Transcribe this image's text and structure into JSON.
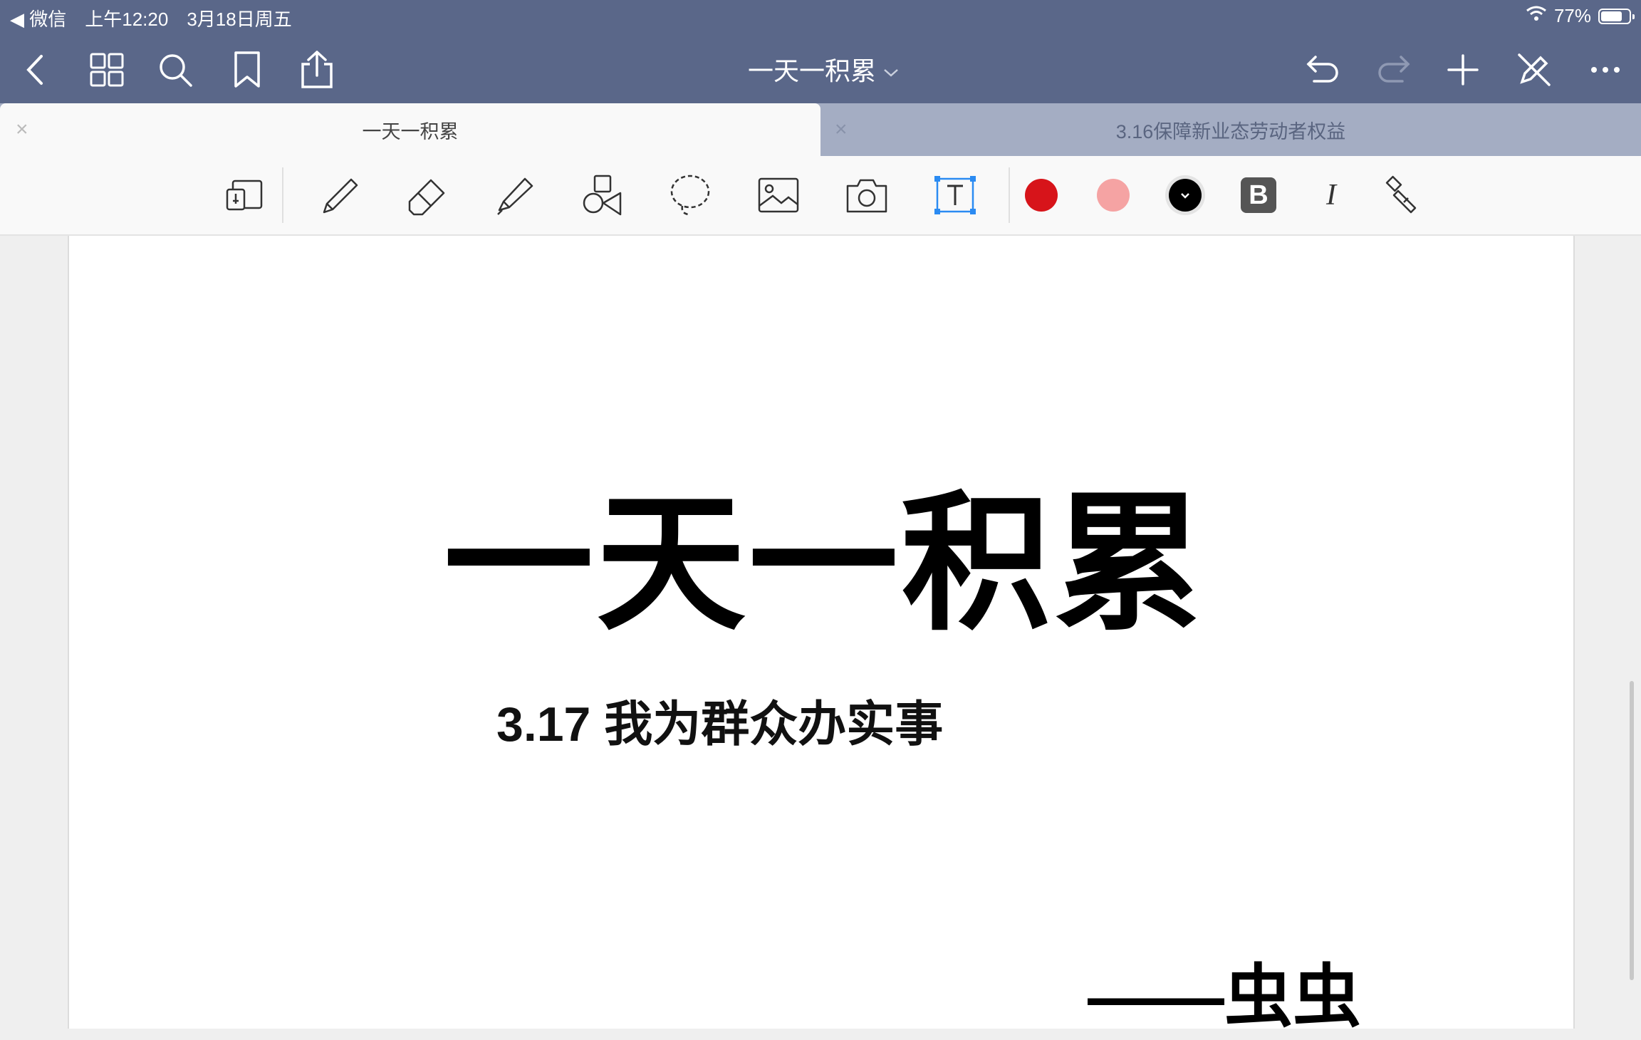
{
  "status_bar": {
    "back_app": "◀ 微信",
    "time": "上午12:20",
    "date": "3月18日周五",
    "battery": "77%",
    "battery_level": 0.77
  },
  "navbar": {
    "title": "一天一积累",
    "icons": [
      "back-icon",
      "grid-icon",
      "search-icon",
      "bookmark-icon",
      "share-icon",
      "undo-icon",
      "redo-icon",
      "plus-icon",
      "pen-off-icon",
      "more-icon"
    ]
  },
  "tabs": [
    {
      "label": "一天一积累",
      "active": true,
      "close": "×"
    },
    {
      "label": "3.16保障新业态劳动者权益",
      "active": false,
      "close": "×"
    }
  ],
  "toolbar": {
    "tools": [
      "read-mode-icon",
      "pen-icon",
      "eraser-icon",
      "highlighter-icon",
      "shapes-icon",
      "lasso-icon",
      "image-icon",
      "camera-icon",
      "text-tool-icon"
    ],
    "colors": [
      "#d7141a",
      "#f5a3a3",
      "#000000"
    ],
    "bold_label": "B",
    "italic_label": "I"
  },
  "document": {
    "title": "一天一积累",
    "subtitle": "3.17 我为群众办实事",
    "author": "——虫虫"
  }
}
